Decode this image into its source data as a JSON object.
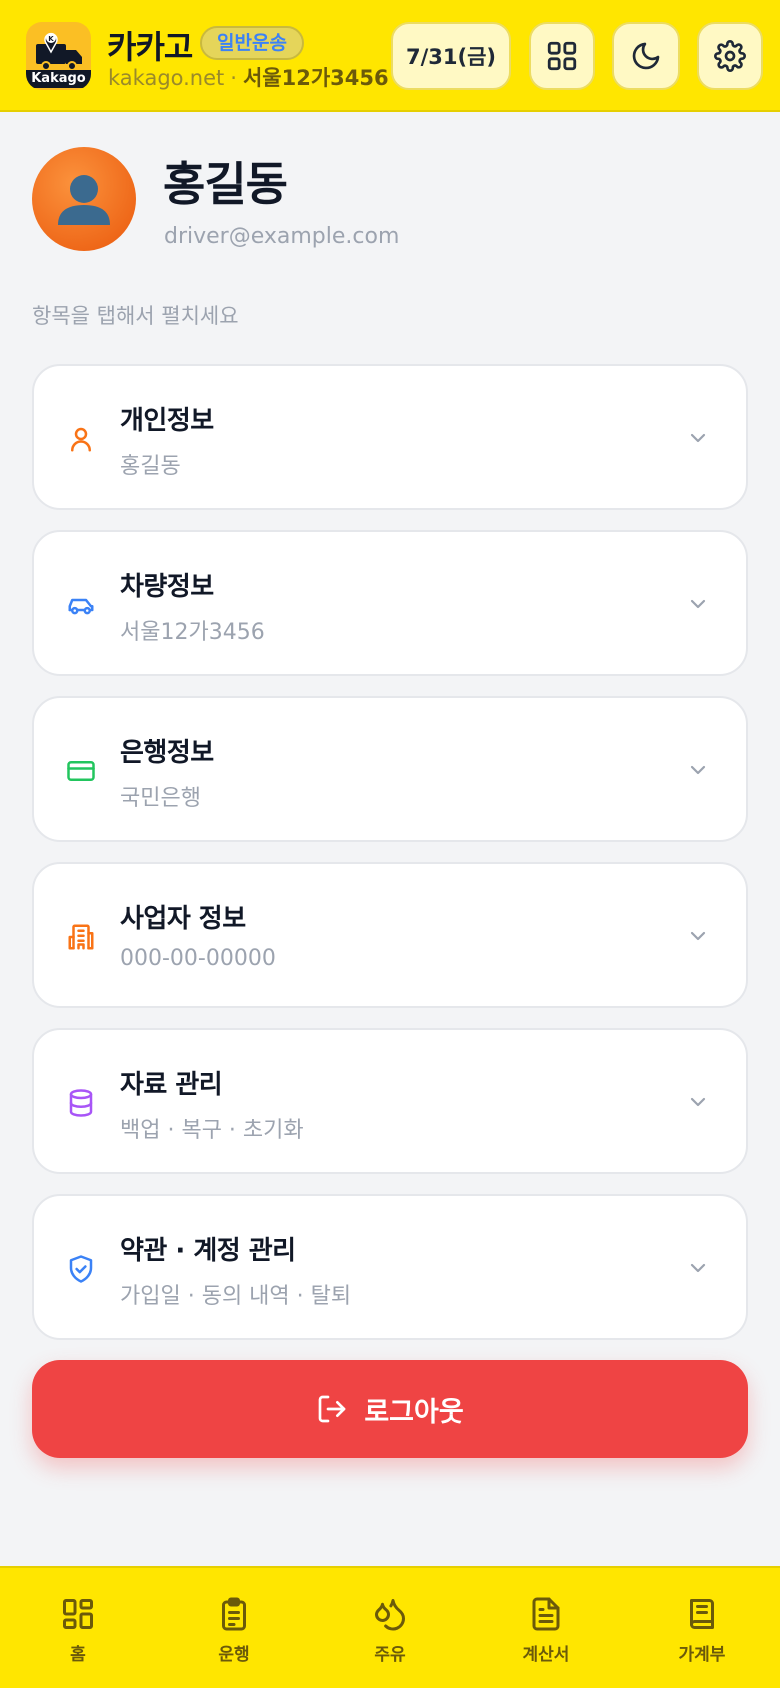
{
  "header": {
    "logo_text": "Kakago",
    "brand_name": "카카고",
    "badge": "일반운송",
    "domain": "kakago.net",
    "separator": "·",
    "plate": "서울12가3456",
    "date": "7/31(금)"
  },
  "profile": {
    "name": "홍길동",
    "email": "driver@example.com"
  },
  "hint": "항목을 탭해서 펼치세요",
  "cards": [
    {
      "title": "개인정보",
      "subtitle": "홍길동",
      "icon": "person-icon",
      "color": "#f97316"
    },
    {
      "title": "차량정보",
      "subtitle": "서울12가3456",
      "icon": "car-icon",
      "color": "#3b82f6"
    },
    {
      "title": "은행정보",
      "subtitle": "국민은행",
      "icon": "credit-card-icon",
      "color": "#22c55e"
    },
    {
      "title": "사업자 정보",
      "subtitle": "000-00-00000",
      "icon": "building-icon",
      "color": "#f97316"
    },
    {
      "title": "자료 관리",
      "subtitle": "백업 · 복구 · 초기화",
      "icon": "database-icon",
      "color": "#a855f7"
    },
    {
      "title": "약관 · 계정 관리",
      "subtitle": "가입일 · 동의 내역 · 탈퇴",
      "icon": "shield-check-icon",
      "color": "#3b82f6"
    }
  ],
  "logout_label": "로그아웃",
  "nav": [
    {
      "label": "홈",
      "icon": "dashboard-icon"
    },
    {
      "label": "운행",
      "icon": "clipboard-icon"
    },
    {
      "label": "주유",
      "icon": "droplets-icon"
    },
    {
      "label": "계산서",
      "icon": "file-text-icon"
    },
    {
      "label": "가계부",
      "icon": "book-icon"
    }
  ],
  "colors": {
    "brand_yellow": "#ffe600",
    "logout_red": "#ef4444",
    "badge_text": "#3b82f6"
  }
}
